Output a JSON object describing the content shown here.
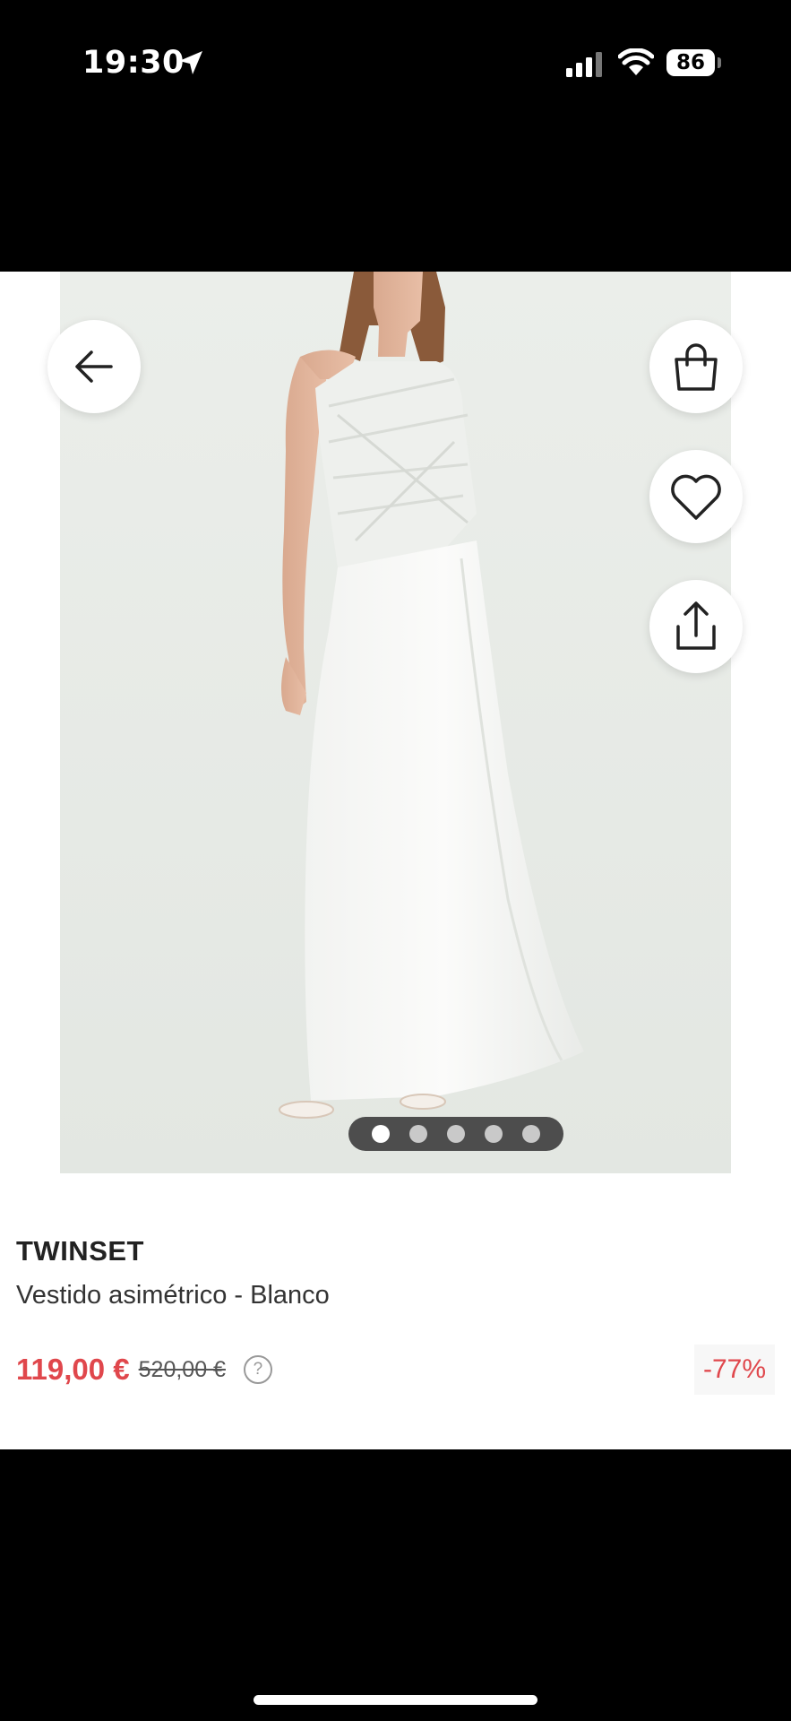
{
  "status_bar": {
    "time": "19:30",
    "battery": "86",
    "icons": [
      "location-arrow-icon",
      "signal-bars-icon",
      "wifi-icon",
      "battery-icon"
    ]
  },
  "toolbar": {
    "icons": [
      "arrow-left-icon",
      "shopping-bag-icon",
      "heart-icon",
      "share-icon"
    ]
  },
  "gallery": {
    "image_count": 5,
    "active_index": 0
  },
  "product": {
    "brand": "TWINSET",
    "name": "Vestido asimétrico - Blanco",
    "price": "119,00 €",
    "original_price": "520,00 €",
    "help": "?",
    "discount": "-77%"
  },
  "colors": {
    "price": "#e0474c",
    "background": "#ffffff",
    "chrome": "#000000"
  }
}
